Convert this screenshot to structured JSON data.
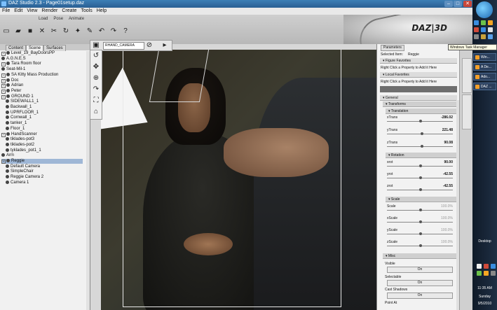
{
  "window": {
    "title": "DAZ Studio 2.3 - Page01setup.daz"
  },
  "menu": [
    "File",
    "Edit",
    "View",
    "Render",
    "Create",
    "Tools",
    "Help"
  ],
  "toolbar": {
    "tabs": [
      "Load",
      "Pose",
      "Animate"
    ],
    "brand": "DAZ|3D"
  },
  "left_panel": {
    "tabs": [
      "Content",
      "Scene",
      "Surfaces"
    ],
    "nodes": [
      "Level_19_BayDoorsPP",
      "A.G.N.E.S",
      "Tara Room floor",
      "Seat-Mil-1",
      "SA Kitty Mass Production",
      "Doc",
      "Adrian",
      "Peter",
      "GROUND 1",
      "SIDEWALL1_1",
      "Backwall_1",
      "UPRFLOOR_1",
      "Cornwall_1",
      "tanker_1",
      "Floor_1",
      "HandScanner",
      "tiklades-pot3",
      "tiklades-pot2",
      "tyklades_pot1_1",
      "Arm",
      "Reggie",
      "Default Camera",
      "SimpleChair",
      "Reggie Camera 2",
      "Camera 1"
    ]
  },
  "viewport": {
    "camera": "RHAND_CAMERA"
  },
  "parameters": {
    "tab": "Parameters",
    "selected_label": "Selected Item:",
    "selected": "Reggie",
    "figure_favorites": "Figure Favorites",
    "local_favorites": "Local Favorites",
    "hint": "Right Click a Property to Add it Here",
    "general": "General",
    "transforms": "Transforms",
    "translation": "Translation",
    "rotation": "Rotation",
    "scale_group": "Scale",
    "misc": "Misc",
    "xtrans_l": "xTrans",
    "xtrans_v": "-286.02",
    "ytrans_l": "yTrans",
    "ytrans_v": "221.48",
    "ztrans_l": "zTrans",
    "ztrans_v": "90.08",
    "xrot_l": "xrot",
    "xrot_v": "90.00",
    "yrot_l": "yrot",
    "yrot_v": "-42.55",
    "zrot_l": "zrot",
    "zrot_v": "-42.55",
    "scale_l": "Scale",
    "scale_v": "100.0%",
    "xscale_l": "xScale",
    "xscale_v": "100.0%",
    "yscale_l": "yScale",
    "yscale_v": "100.0%",
    "zscale_l": "zScale",
    "zscale_v": "100.0%",
    "visible_l": "Visible",
    "visible_v": "On",
    "selectable_l": "Selectable",
    "selectable_v": "On",
    "cast_l": "Cast Shadows",
    "cast_v": "On",
    "point_at": "Point At"
  },
  "taskbar": {
    "items": [
      "Win...",
      "A De...",
      "Ado...",
      "DAZ ..."
    ],
    "tooltip": "Windows Task Manager",
    "desktop": "Desktop",
    "time": "11:35 AM",
    "day": "Sunday",
    "date": "9/5/2010"
  }
}
